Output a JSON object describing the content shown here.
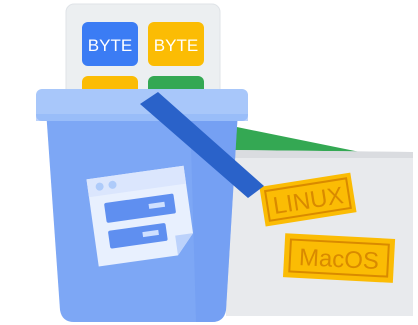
{
  "illustration": {
    "chips": [
      {
        "label": "BYTE",
        "color": "#3b7cf4"
      },
      {
        "label": "BYTE",
        "color": "#fbbc04"
      }
    ],
    "hidden_chip_colors": [
      "#fbbc04",
      "#34a853"
    ],
    "stamps": [
      {
        "label": "LINUX"
      },
      {
        "label": "MacOS"
      }
    ],
    "colors": {
      "card": "#eceff1",
      "bucket_body": "#7da7f5",
      "bucket_rim": "#a8c7fa",
      "handle": "#2a62c9",
      "folder_back": "#34a853",
      "folder_front": "#e8eaed",
      "stamp": "#fbbc04",
      "doc": "#e8f0fe"
    }
  }
}
